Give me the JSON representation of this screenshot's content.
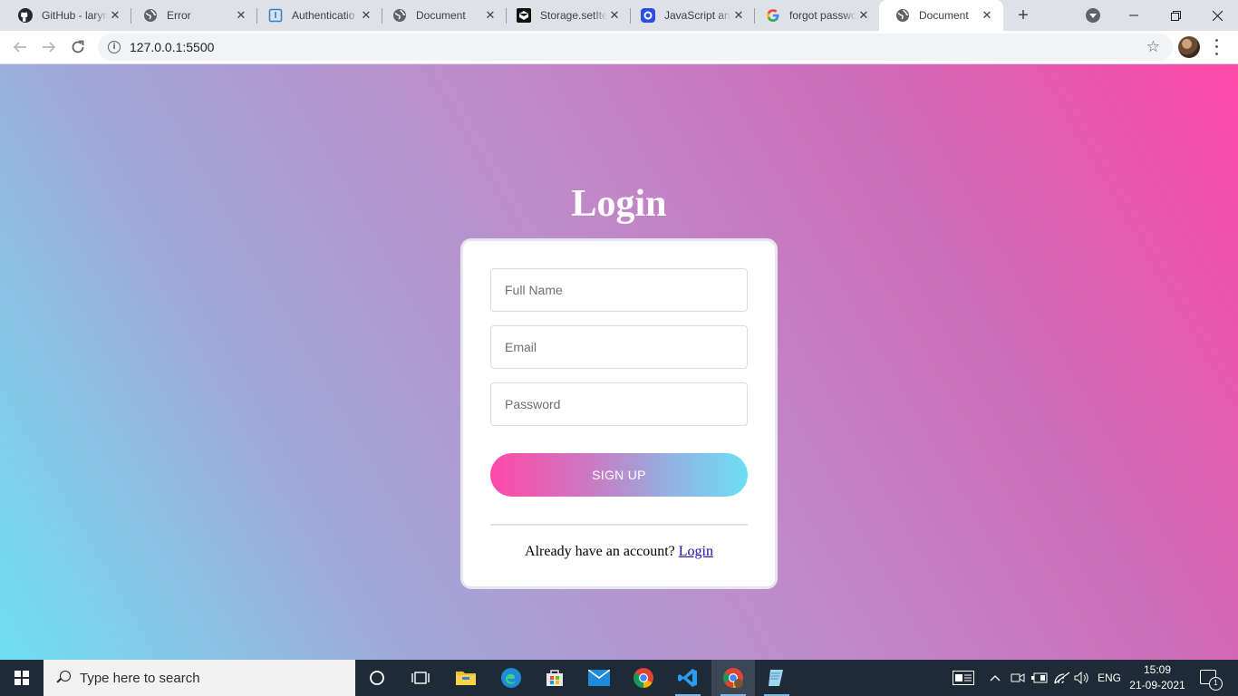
{
  "browser": {
    "tabs": [
      {
        "title": "GitHub - larym",
        "icon": "github-icon"
      },
      {
        "title": "Error",
        "icon": "globe-icon"
      },
      {
        "title": "Authenticatio",
        "icon": "docs-icon"
      },
      {
        "title": "Document",
        "icon": "globe-icon"
      },
      {
        "title": "Storage.setIte",
        "icon": "codepen-icon"
      },
      {
        "title": "JavaScript and",
        "icon": "scrimba-icon"
      },
      {
        "title": "forgot passwo",
        "icon": "google-icon"
      },
      {
        "title": "Document",
        "icon": "globe-icon"
      }
    ],
    "new_tab_label": "+",
    "url": "127.0.0.1:5500"
  },
  "page": {
    "heading": "Login",
    "fields": {
      "full_name_placeholder": "Full Name",
      "email_placeholder": "Email",
      "password_placeholder": "Password"
    },
    "signup_button": "SIGN UP",
    "footer_text": "Already have an account?",
    "footer_link": "Login"
  },
  "taskbar": {
    "search_placeholder": "Type here to search",
    "language": "ENG",
    "time": "15:09",
    "date": "21-09-2021",
    "notification_count": "1"
  },
  "colors": {
    "gradient_start": "#6fe0f3",
    "gradient_end": "#fd48a6",
    "button_pink": "#fe49a7",
    "button_cyan": "#6cdff2"
  }
}
